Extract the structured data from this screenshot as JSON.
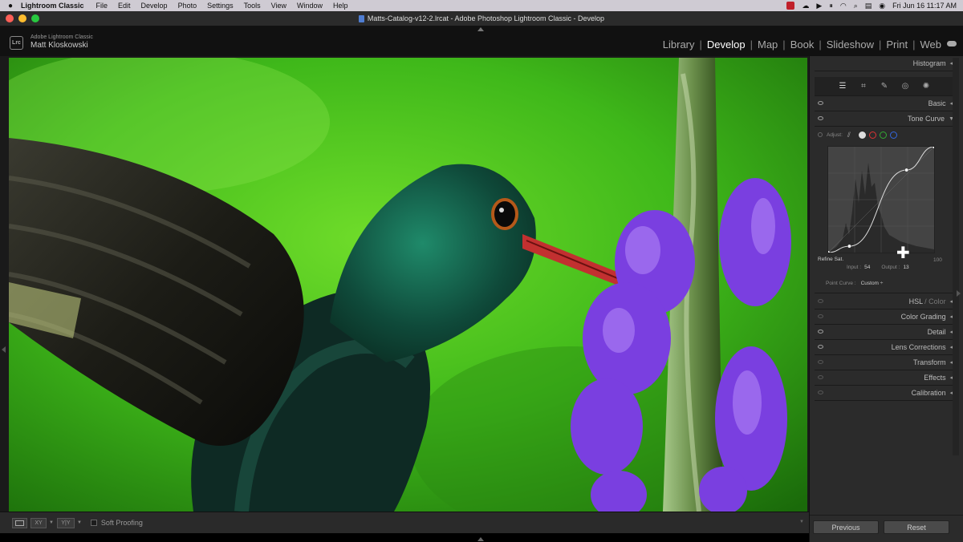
{
  "menubar": {
    "app": "Lightroom Classic",
    "items": [
      "File",
      "Edit",
      "Develop",
      "Photo",
      "Settings",
      "Tools",
      "View",
      "Window",
      "Help"
    ],
    "datetime": "Fri Jun 16  11:17 AM"
  },
  "window": {
    "title": "Matts-Catalog-v12-2.lrcat - Adobe Photoshop Lightroom Classic - Develop"
  },
  "identity": {
    "logo": "Lrc",
    "product": "Adobe Lightroom Classic",
    "user": "Matt Kloskowski"
  },
  "modules": {
    "library": "Library",
    "develop": "Develop",
    "map": "Map",
    "book": "Book",
    "slideshow": "Slideshow",
    "print": "Print",
    "web": "Web",
    "separator": "|"
  },
  "right_panel": {
    "histogram": "Histogram",
    "basic": "Basic",
    "tone_curve": "Tone Curve",
    "hsl": "HSL",
    "hsl_color": "/ Color",
    "color_grading": "Color Grading",
    "detail": "Detail",
    "lens_corrections": "Lens Corrections",
    "transform": "Transform",
    "effects": "Effects",
    "calibration": "Calibration",
    "collapse_arrow": "◀",
    "expand_arrow": "▼"
  },
  "tone_curve": {
    "adjust_label": "Adjust:",
    "refine_label": "Refine Sat.",
    "max_value": "100",
    "input_label": "Input :",
    "input_value": "54",
    "output_label": "Output :",
    "output_value": "13",
    "point_curve_label": "Point Curve :",
    "point_curve_value": "Custom ÷",
    "channel_colors": {
      "red": "#d33",
      "green": "#3a3",
      "blue": "#36d"
    },
    "curve_points": [
      {
        "input": 0,
        "output": 0
      },
      {
        "input": 20,
        "output": 6
      },
      {
        "input": 74,
        "output": 78
      },
      {
        "input": 100,
        "output": 100
      }
    ]
  },
  "toolbar": {
    "view_single": "",
    "compare_xy": "XY",
    "compare_yy": "Y|Y",
    "soft_proofing": "Soft Proofing"
  },
  "buttons": {
    "previous": "Previous",
    "reset": "Reset"
  },
  "photo": {
    "background_color": "#3fb81a",
    "flower_color": "#7a3fe0",
    "beak_color": "#c23030"
  }
}
